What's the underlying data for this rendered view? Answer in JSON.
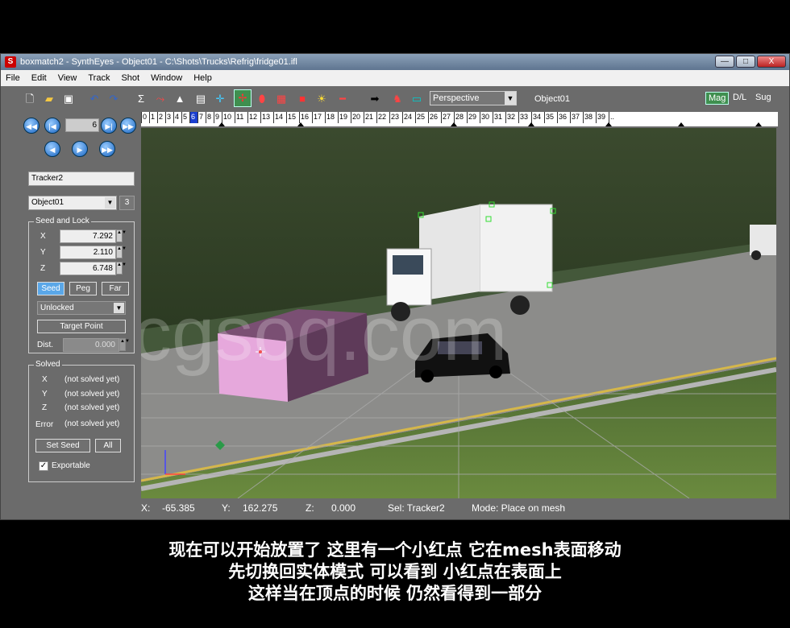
{
  "window": {
    "title": "boxmatch2 - SynthEyes - Object01 - C:\\Shots\\Trucks\\Refrig\\fridge01.ifl",
    "app_icon": "S",
    "minimize": "—",
    "maximize": "□",
    "close": "X"
  },
  "menu": [
    "File",
    "Edit",
    "View",
    "Track",
    "Shot",
    "Window",
    "Help"
  ],
  "toolbar": {
    "view_mode": "Perspective",
    "object_name": "Object01",
    "right_buttons": [
      "Mag",
      "D/L",
      "Sug"
    ]
  },
  "playback": {
    "frame": "6"
  },
  "timeline": {
    "frames": [
      "0",
      "1",
      "2",
      "3",
      "4",
      "5",
      "6",
      "7",
      "8",
      "9",
      "10",
      "11",
      "12",
      "13",
      "14",
      "15",
      "16",
      "17",
      "18",
      "19",
      "20",
      "21",
      "22",
      "23",
      "24",
      "25",
      "26",
      "27",
      "28",
      "29",
      "30",
      "31",
      "32",
      "33",
      "34",
      "35",
      "36",
      "37",
      "38",
      "39",
      ".."
    ],
    "current": "6"
  },
  "tracker_panel": {
    "tracker_name": "Tracker2",
    "object_select": "Object01",
    "object_count": "3",
    "seed_lock_label": "Seed and Lock",
    "x_label": "X",
    "x_value": "7.292",
    "y_label": "Y",
    "y_value": "2.110",
    "z_label": "Z",
    "z_value": "6.748",
    "seed_btn": "Seed",
    "peg_btn": "Peg",
    "far_btn": "Far",
    "lock_select": "Unlocked",
    "target_point_btn": "Target Point",
    "dist_label": "Dist.",
    "dist_value": "0.000",
    "solved_label": "Solved",
    "solved_x_label": "X",
    "solved_x": "(not solved yet)",
    "solved_y_label": "Y",
    "solved_y": "(not solved yet)",
    "solved_z_label": "Z",
    "solved_z": "(not solved yet)",
    "error_label": "Error",
    "error_value": "(not solved yet)",
    "set_seed_btn": "Set Seed",
    "all_btn": "All",
    "exportable_label": "Exportable",
    "exportable_checked": true
  },
  "viewport": {
    "watermark": "cgsoq.com"
  },
  "status": {
    "x_label": "X:",
    "x": "-65.385",
    "y_label": "Y:",
    "y": "162.275",
    "z_label": "Z:",
    "z": "0.000",
    "sel": "Sel: Tracker2",
    "mode": "Mode: Place on mesh"
  },
  "subtitles": [
    "现在可以开始放置了 这里有一个小红点 它在mesh表面移动",
    "先切换回实体模式 可以看到 小红点在表面上",
    "这样当在顶点的时候 仍然看得到一部分"
  ]
}
